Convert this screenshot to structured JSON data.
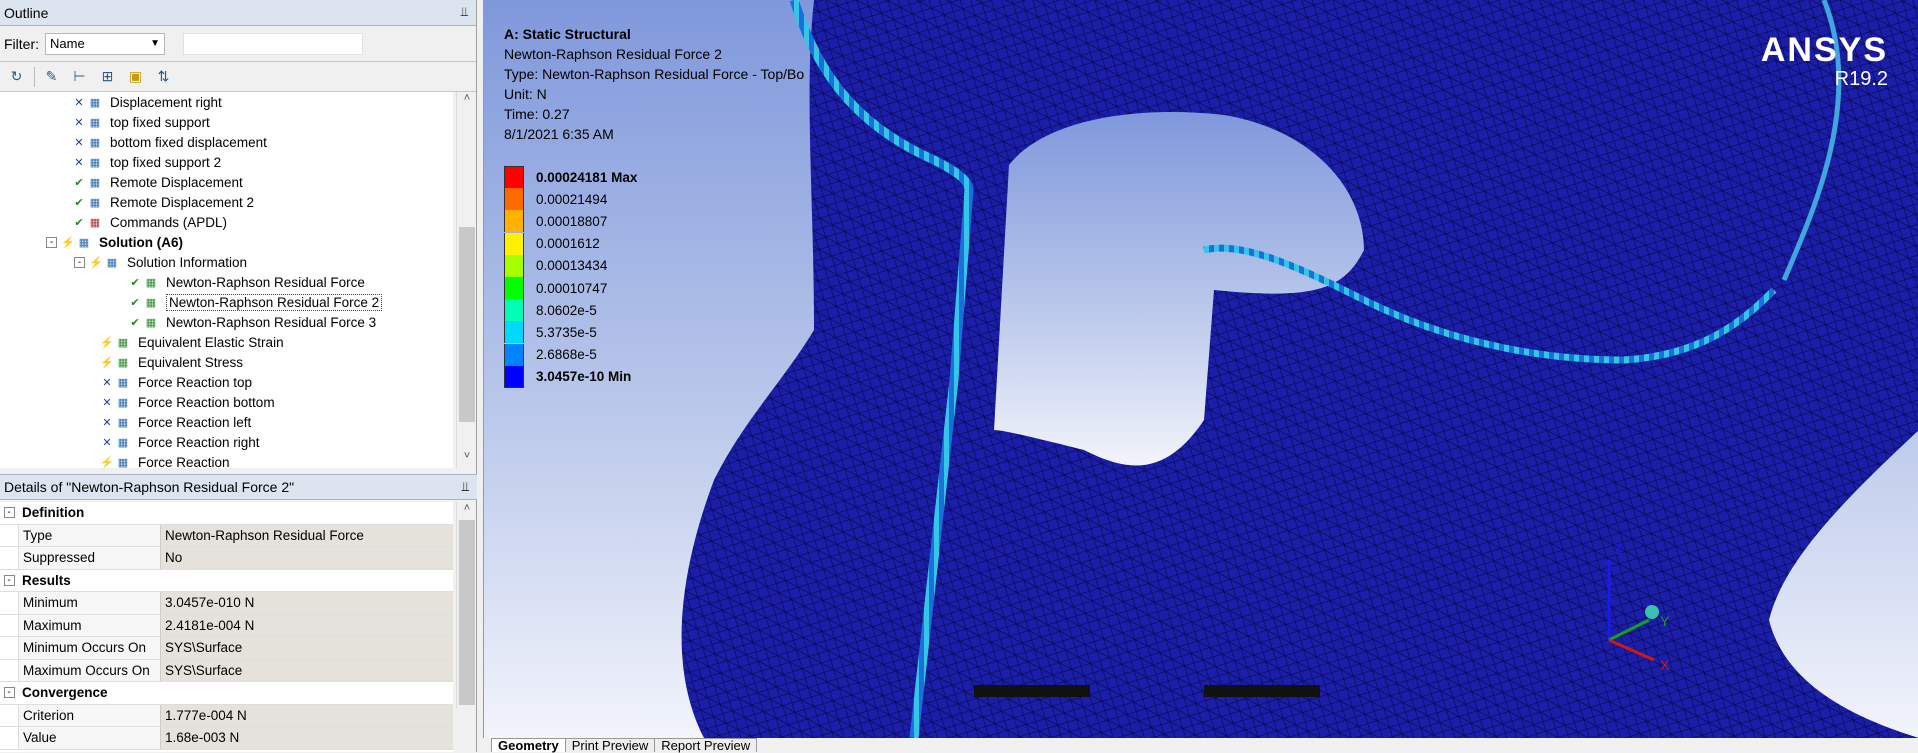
{
  "outline": {
    "title": "Outline",
    "filter_label": "Filter:",
    "filter_value": "Name",
    "tree": [
      {
        "label": "Displacement right",
        "status": "x",
        "icon": "displacement-icon",
        "indent": 3
      },
      {
        "label": "top fixed support",
        "status": "x",
        "icon": "fixed-support-icon",
        "indent": 3
      },
      {
        "label": "bottom fixed displacement",
        "status": "x",
        "icon": "displacement-icon",
        "indent": 3
      },
      {
        "label": "top fixed support 2",
        "status": "x",
        "icon": "fixed-support-icon",
        "indent": 3
      },
      {
        "label": "Remote Displacement",
        "status": "check",
        "icon": "remote-displacement-icon",
        "indent": 3
      },
      {
        "label": "Remote Displacement 2",
        "status": "check",
        "icon": "remote-displacement-icon",
        "indent": 3
      },
      {
        "label": "Commands (APDL)",
        "status": "check",
        "icon": "commands-icon",
        "indent": 3
      },
      {
        "label": "Solution (A6)",
        "status": "bolt",
        "icon": "solution-icon",
        "indent": 2,
        "bold": true,
        "expander": "-"
      },
      {
        "label": "Solution Information",
        "status": "bolt",
        "icon": "solution-information-icon",
        "indent": 3,
        "expander": "-"
      },
      {
        "label": "Newton-Raphson Residual Force",
        "status": "check",
        "icon": "result-icon",
        "indent": 5
      },
      {
        "label": "Newton-Raphson Residual Force 2",
        "status": "check",
        "icon": "result-icon",
        "indent": 5,
        "selected": true
      },
      {
        "label": "Newton-Raphson Residual Force 3",
        "status": "check",
        "icon": "result-icon",
        "indent": 5
      },
      {
        "label": "Equivalent Elastic Strain",
        "status": "bolt",
        "icon": "result-icon",
        "indent": 4
      },
      {
        "label": "Equivalent Stress",
        "status": "bolt",
        "icon": "result-icon",
        "indent": 4
      },
      {
        "label": "Force Reaction top",
        "status": "x",
        "icon": "probe-icon",
        "indent": 4
      },
      {
        "label": "Force Reaction bottom",
        "status": "x",
        "icon": "probe-icon",
        "indent": 4
      },
      {
        "label": "Force Reaction left",
        "status": "x",
        "icon": "probe-icon",
        "indent": 4
      },
      {
        "label": "Force Reaction right",
        "status": "x",
        "icon": "probe-icon",
        "indent": 4
      },
      {
        "label": "Force Reaction",
        "status": "bolt",
        "icon": "probe-icon",
        "indent": 4
      }
    ]
  },
  "details": {
    "title": "Details of \"Newton-Raphson Residual Force 2\"",
    "rows": [
      {
        "section": "Definition"
      },
      {
        "key": "Type",
        "value": "Newton-Raphson Residual Force"
      },
      {
        "key": "Suppressed",
        "value": "No"
      },
      {
        "section": "Results"
      },
      {
        "key": "Minimum",
        "value": "3.0457e-010 N"
      },
      {
        "key": "Maximum",
        "value": "2.4181e-004 N"
      },
      {
        "key": "Minimum Occurs On",
        "value": "SYS\\Surface"
      },
      {
        "key": "Maximum Occurs On",
        "value": "SYS\\Surface"
      },
      {
        "section": "Convergence"
      },
      {
        "key": "Criterion",
        "value": "1.777e-004 N"
      },
      {
        "key": "Value",
        "value": "1.68e-003 N"
      }
    ]
  },
  "viewport": {
    "title": "A: Static Structural",
    "result_name": "Newton-Raphson Residual Force 2",
    "type_line": "Type: Newton-Raphson Residual Force - Top/Bo",
    "unit_line": "Unit: N",
    "time_line": "Time: 0.27",
    "date_line": "8/1/2021 6:35 AM",
    "legend": [
      {
        "label": "0.00024181 Max",
        "color": "#ff0000",
        "bold": true
      },
      {
        "label": "0.00021494",
        "color": "#ff6a00"
      },
      {
        "label": "0.00018807",
        "color": "#ffb000"
      },
      {
        "label": "0.0001612",
        "color": "#fff000"
      },
      {
        "label": "0.00013434",
        "color": "#a6ff00"
      },
      {
        "label": "0.00010747",
        "color": "#00ff00"
      },
      {
        "label": "8.0602e-5",
        "color": "#00ffb4"
      },
      {
        "label": "5.3735e-5",
        "color": "#00d8ff"
      },
      {
        "label": "2.6868e-5",
        "color": "#0084ff"
      },
      {
        "label": "3.0457e-10 Min",
        "color": "#0000ff",
        "bold": true
      }
    ],
    "brand": "ANSYS",
    "version": "R19.2",
    "axes": {
      "z": "Z",
      "y": "Y",
      "x": "X"
    }
  },
  "tabs": [
    "Geometry",
    "Print Preview",
    "Report Preview"
  ]
}
